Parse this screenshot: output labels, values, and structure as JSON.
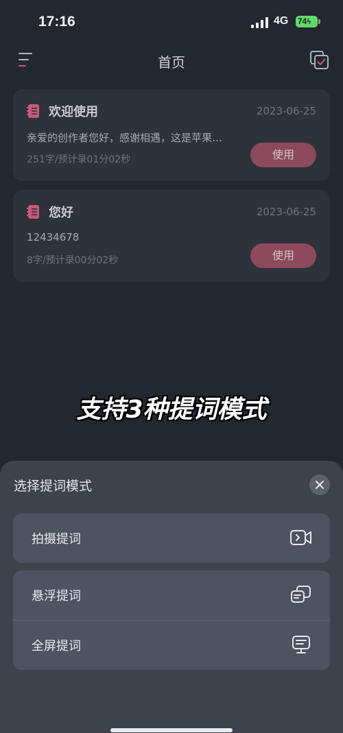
{
  "status_bar": {
    "time": "17:16",
    "network": "4G",
    "battery": "74"
  },
  "nav": {
    "title": "首页",
    "icons": [
      "menu-icon",
      "copy-check-icon"
    ]
  },
  "scripts": [
    {
      "title": "欢迎使用",
      "date": "2023-06-25",
      "preview": "亲爱的创作者您好，感谢相遇，这是苹果…",
      "meta": "251字/预计录01分02秒",
      "use_label": "使用"
    },
    {
      "title": "您好",
      "date": "2023-06-25",
      "preview": "12434678",
      "meta": "8字/预计录00分02秒",
      "use_label": "使用"
    }
  ],
  "caption": "支持3种提词模式",
  "sheet": {
    "title": "选择提词模式",
    "close_icon": "close-icon",
    "options": [
      {
        "label": "拍摄提词",
        "icon": "video-camera-icon"
      },
      {
        "label": "悬浮提词",
        "icon": "floating-window-icon"
      },
      {
        "label": "全屏提词",
        "icon": "fullscreen-monitor-icon"
      }
    ]
  },
  "colors": {
    "background": "#222730",
    "card": "#2d323b",
    "accent": "#8c4a5c",
    "accent_icon": "#c75a78",
    "sheet": "#3d424d",
    "option": "#4d5361",
    "battery": "#5fdb6b"
  }
}
